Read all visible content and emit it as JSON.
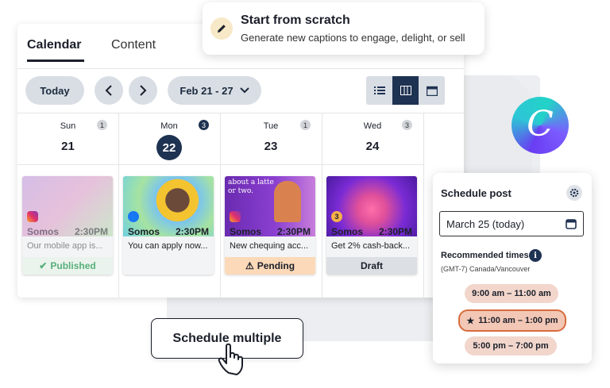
{
  "scratch": {
    "title": "Start from scratch",
    "subtitle": "Generate new captions to engage, delight, or sell",
    "icon": "pencil-icon"
  },
  "tabs": [
    {
      "label": "Calendar",
      "active": true
    },
    {
      "label": "Content",
      "active": false
    }
  ],
  "toolbar": {
    "today_label": "Today",
    "range_label": "Feb 21 - 27",
    "views": [
      "list-view-icon",
      "week-view-icon",
      "month-view-icon"
    ],
    "active_view": "week-view-icon"
  },
  "days": [
    {
      "name": "Sun",
      "num": "21",
      "count": "1"
    },
    {
      "name": "Mon",
      "num": "22",
      "count": "3",
      "selected": true
    },
    {
      "name": "Tue",
      "num": "23",
      "count": "1"
    },
    {
      "name": "Wed",
      "num": "24",
      "count": "3"
    }
  ],
  "posts": [
    {
      "account": "Somos",
      "time": "2:30PM",
      "text": "Our mobile app is...",
      "status": "Published",
      "network": "instagram"
    },
    {
      "account": "Somos",
      "time": "2:30PM",
      "text": "You can apply now...",
      "status": "",
      "network": "facebook"
    },
    {
      "account": "Somos",
      "time": "2:30PM",
      "text": "New chequing acc...",
      "status": "Pending",
      "network": "instagram",
      "image_text": "about a latte or two."
    },
    {
      "account": "Somos",
      "time": "2:30PM",
      "text": "Get 2% cash-back...",
      "status": "Draft",
      "network": "",
      "badge": "3"
    }
  ],
  "schedule_multiple": "Schedule multiple",
  "logo_letter": "C",
  "schedule_post": {
    "title": "Schedule post",
    "date_value": "March 25 (today)",
    "recommended_label": "Recommended times",
    "info": "i",
    "timezone": "(GMT-7) Canada/Vancouver",
    "times": [
      {
        "label": "9:00 am – 11:00 am",
        "selected": false
      },
      {
        "label": "11:00 am – 1:00 pm",
        "selected": true
      },
      {
        "label": "5:00 pm – 7:00 pm",
        "selected": false
      }
    ]
  },
  "colors": {
    "navy": "#1e3251",
    "published": "#2f9e5a",
    "pending_bg": "#fcd9b8",
    "draft_bg": "#dcdfe3",
    "chip": "#f2d6cc",
    "chip_selected_border": "#d86b3d"
  }
}
